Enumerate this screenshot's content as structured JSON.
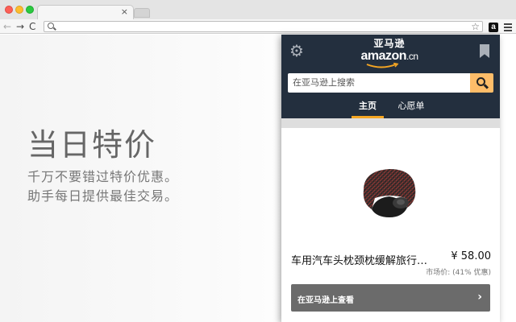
{
  "browser": {
    "tab_close": "×",
    "nav_back": "←",
    "nav_forward": "→",
    "nav_reload": "C",
    "bookmark_star": "☆",
    "extension_icon": "a"
  },
  "hero": {
    "title": "当日特价",
    "line1": "千万不要错过特价优惠。",
    "line2": "助手每日提供最佳交易。"
  },
  "popup": {
    "logo_cn": "亚马逊",
    "logo_en": "amazon",
    "logo_suffix": ".cn",
    "search_placeholder": "在亚马逊上搜索",
    "tabs": [
      {
        "label": "主页",
        "active": true
      },
      {
        "label": "心愿单",
        "active": false
      }
    ],
    "product": {
      "title": "车用汽车头枕颈枕缓解旅行疲劳",
      "price": "¥ 58.00",
      "market_price": "市场价: (41% 优惠)"
    },
    "view_button": "在亚马逊上查看",
    "view_chevron": "›"
  },
  "colors": {
    "header_bg": "#232f3e",
    "accent": "#f5a623",
    "search_button": "#febd69",
    "view_button_bg": "#6b6b6b"
  }
}
